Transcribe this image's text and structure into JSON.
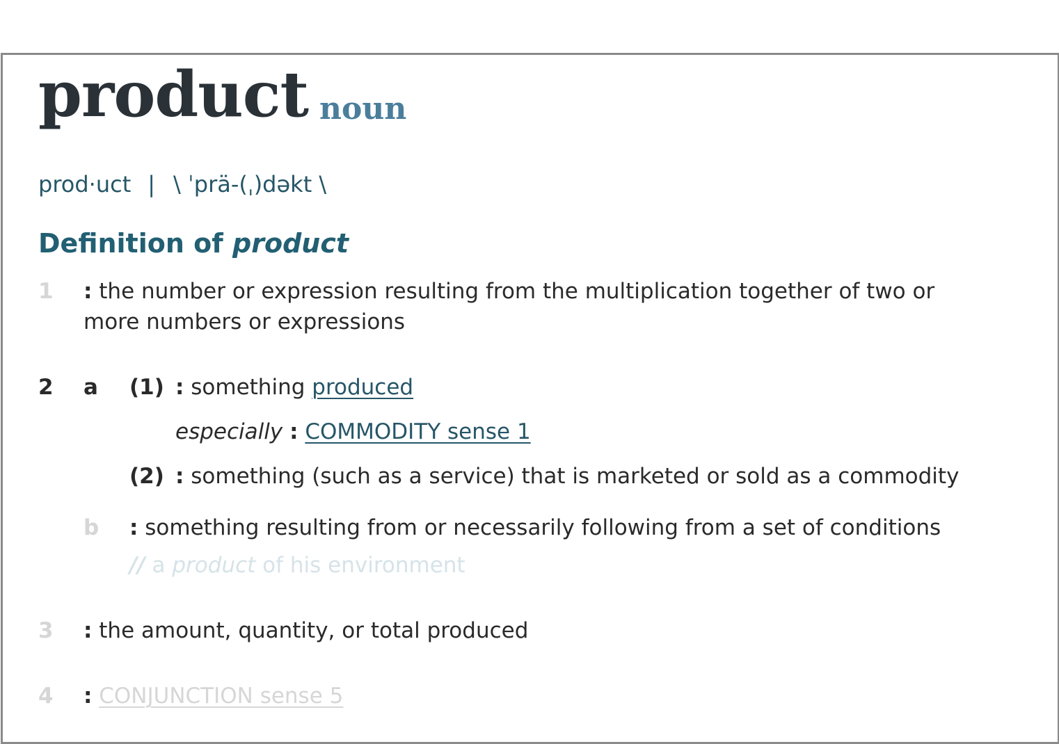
{
  "entry": {
    "headword": "product",
    "part_of_speech": "noun",
    "syllables": "prod·uct",
    "separator": "|",
    "pronunciation": "\\ ˈprä-(ˌ)dəkt  \\"
  },
  "definition_heading": {
    "prefix": "Definition of",
    "word": "product"
  },
  "senses": {
    "s1": {
      "num": "1",
      "colon": ":",
      "text_line1": "the number or expression resulting from the multiplication together of two or",
      "text_line2": "more numbers or expressions"
    },
    "s2": {
      "num": "2",
      "letter": "a",
      "sub1": {
        "num": "(1)",
        "colon": ":",
        "text": "something",
        "link": "produced",
        "label": "especially",
        "label_colon": ":",
        "xref": "COMMODITY sense 1"
      },
      "sub2": {
        "num": "(2)",
        "colon": ":",
        "text": "something (such as a service) that is marketed or sold as a commodity"
      },
      "b": {
        "letter": "b",
        "colon": ":",
        "text": "something resulting from or necessarily following from a set of conditions",
        "example_slashes": "//",
        "example_pre": "a",
        "example_word": "product",
        "example_post": "of his environment"
      }
    },
    "s3": {
      "num": "3",
      "colon": ":",
      "text": "the amount, quantity, or total produced"
    },
    "s4": {
      "num": "4",
      "colon": ":",
      "xref": "CONJUNCTION sense 5"
    }
  },
  "colors": {
    "headword": "#2a3238",
    "part_of_speech": "#4a7e9b",
    "accent": "#265667",
    "faded_text": "#d6d6d6",
    "frame_border": "#8a8a8a"
  }
}
